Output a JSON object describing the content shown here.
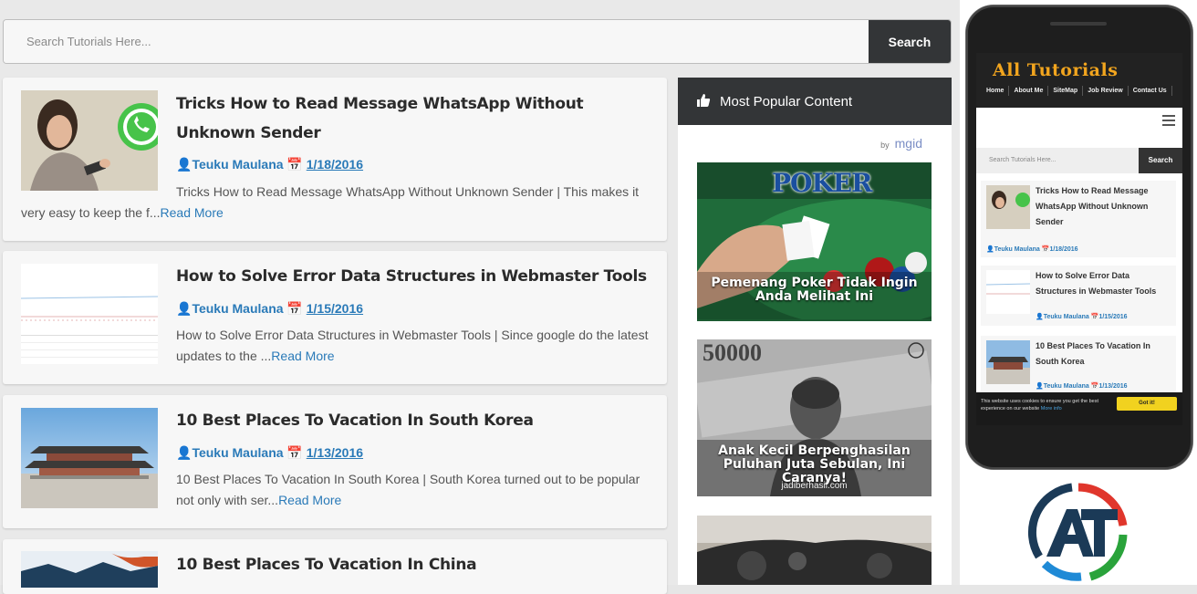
{
  "search": {
    "placeholder": "Search Tutorials Here...",
    "button": "Search"
  },
  "posts": [
    {
      "title": "Tricks How to Read Message WhatsApp Without Unknown Sender",
      "author": "Teuku Maulana",
      "date": "1/18/2016",
      "excerpt": "Tricks How to Read Message WhatsApp Without Unknown Sender | This makes it very easy to keep the f...",
      "more": "Read More"
    },
    {
      "title": "How to Solve Error Data Structures in Webmaster Tools",
      "author": "Teuku Maulana",
      "date": "1/15/2016",
      "excerpt": "How to Solve Error Data Structures in Webmaster Tools | Since google do the latest updates to the ...",
      "more": "Read More"
    },
    {
      "title": "10 Best Places To Vacation In South Korea",
      "author": "Teuku Maulana",
      "date": "1/13/2016",
      "excerpt": "10 Best Places To Vacation In South Korea | South Korea turned out to be popular not only with ser...",
      "more": "Read More"
    },
    {
      "title": "10 Best Places To Vacation In China"
    }
  ],
  "sidebar": {
    "title": "Most Popular Content",
    "by_label": "by",
    "mgid": "mgid",
    "ads": [
      {
        "caption": "Pemenang Poker Tidak Ingin Anda Melihat Ini",
        "logo": "POKER"
      },
      {
        "caption": "Anak Kecil Berpenghasilan Puluhan Juta Sebulan, Ini Caranya!",
        "source": "jadiberhasil.com",
        "banknote": "50000"
      }
    ]
  },
  "phone": {
    "logo": "All Tutorials",
    "nav": [
      "Home",
      "About Me",
      "SiteMap",
      "Job Review",
      "Contact Us"
    ],
    "search_placeholder": "Search Tutorials Here...",
    "search_button": "Search",
    "posts": [
      {
        "title": "Tricks How to Read Message WhatsApp Without Unknown Sender",
        "author": "Teuku Maulana",
        "date": "1/18/2016"
      },
      {
        "title": "How to Solve Error Data Structures in Webmaster Tools",
        "author": "Teuku Maulana",
        "date": "1/15/2016"
      },
      {
        "title": "10 Best Places To Vacation In South Korea",
        "author": "Teuku Maulana",
        "date": "1/13/2016"
      }
    ],
    "cookie_text": "This website uses cookies to ensure you get the best experience on our website",
    "cookie_more": "More info",
    "cookie_button": "Got it!"
  },
  "brand": {
    "logo_text": "AT",
    "colors": [
      "#1b3a57",
      "#e0362c",
      "#2aa33b",
      "#1f8ad6"
    ]
  },
  "icons": [
    "user-icon",
    "calendar-icon",
    "thumbs-up-icon",
    "hamburger-icon"
  ]
}
